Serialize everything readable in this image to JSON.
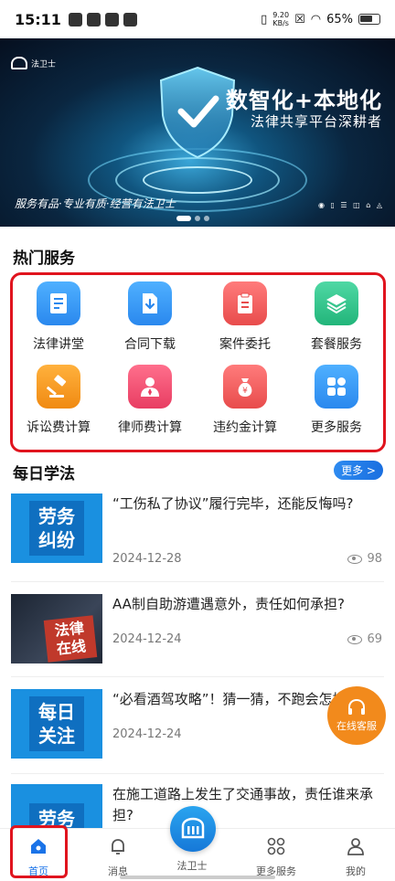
{
  "status_bar": {
    "time": "15:11",
    "net_speed_value": "9.20",
    "net_speed_unit": "KB/s",
    "battery": "65%"
  },
  "banner": {
    "logo_text": "法卫士",
    "headline": "数智化+本地化",
    "subline": "法律共享平台深耕者",
    "slogan": "服务有品·专业有质·经营有法卫士",
    "active_slide": 1,
    "slide_count": 3
  },
  "hot_services": {
    "title": "热门服务",
    "items": [
      {
        "label": "法律讲堂",
        "icon": "book-icon",
        "color": "#2f97f1"
      },
      {
        "label": "合同下载",
        "icon": "download-icon",
        "color": "#2f97f1"
      },
      {
        "label": "案件委托",
        "icon": "clipboard-icon",
        "color": "#ef5b5b"
      },
      {
        "label": "套餐服务",
        "icon": "layers-icon",
        "color": "#2fc18a"
      },
      {
        "label": "诉讼费计算",
        "icon": "gavel-icon",
        "color": "#f59a23"
      },
      {
        "label": "律师费计算",
        "icon": "lawyer-icon",
        "color": "#ef4f6b"
      },
      {
        "label": "违约金计算",
        "icon": "money-bag-icon",
        "color": "#ef5b5b"
      },
      {
        "label": "更多服务",
        "icon": "grid-icon",
        "color": "#2f97f1"
      }
    ]
  },
  "daily_law": {
    "title": "每日学法",
    "more_label": "更多 >",
    "articles": [
      {
        "title": "“工伤私了协议”履行完毕，还能反悔吗?",
        "date": "2024-12-28",
        "views": "98",
        "thumb_text_1": "劳务",
        "thumb_text_2": "纠纷"
      },
      {
        "title": "AA制自助游遭遇意外，责任如何承担?",
        "date": "2024-12-24",
        "views": "69",
        "thumb_text_1": "法律",
        "thumb_text_2": "在线"
      },
      {
        "title": "“必看酒驾攻略”！猜一猜，不跑会怎样?",
        "date": "2024-12-24",
        "views": "",
        "thumb_text_1": "每日",
        "thumb_text_2": "关注"
      },
      {
        "title": "在施工道路上发生了交通事故，责任谁来承担?",
        "date": "",
        "views": "",
        "thumb_text_1": "劳务",
        "thumb_text_2": ""
      }
    ]
  },
  "online_service_label": "在线客服",
  "tabbar": {
    "items": [
      {
        "label": "首页",
        "icon": "home-icon"
      },
      {
        "label": "消息",
        "icon": "bell-icon"
      },
      {
        "label": "法卫士",
        "icon": "fawei-logo-icon"
      },
      {
        "label": "更多服务",
        "icon": "grid-icon"
      },
      {
        "label": "我的",
        "icon": "user-icon"
      }
    ]
  }
}
